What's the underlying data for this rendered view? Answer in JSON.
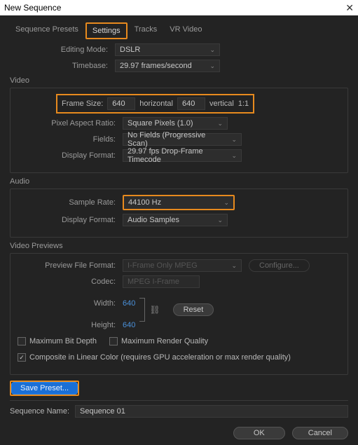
{
  "title": "New Sequence",
  "tabs": {
    "presets": "Sequence Presets",
    "settings": "Settings",
    "tracks": "Tracks",
    "vr": "VR Video"
  },
  "labels": {
    "editingMode": "Editing Mode:",
    "timebase": "Timebase:",
    "video": "Video",
    "frameSize": "Frame Size:",
    "horizontal": "horizontal",
    "vertical": "vertical",
    "par": "Pixel Aspect Ratio:",
    "fields": "Fields:",
    "displayFormat": "Display Format:",
    "audio": "Audio",
    "sampleRate": "Sample Rate:",
    "videoPreviews": "Video Previews",
    "previewFormat": "Preview File Format:",
    "codec": "Codec:",
    "width": "Width:",
    "height": "Height:",
    "maxBitDepth": "Maximum Bit Depth",
    "maxRender": "Maximum Render Quality",
    "linearColor": "Composite in Linear Color (requires GPU acceleration or max render quality)",
    "savePreset": "Save Preset...",
    "seqName": "Sequence Name:",
    "configure": "Configure...",
    "reset": "Reset",
    "ok": "OK",
    "cancel": "Cancel"
  },
  "values": {
    "editingMode": "DSLR",
    "timebase": "29.97 frames/second",
    "frameW": "640",
    "frameH": "640",
    "aspect": "1:1",
    "par": "Square Pixels (1.0)",
    "fields": "No Fields (Progressive Scan)",
    "displayFormatV": "29.97 fps Drop-Frame Timecode",
    "sampleRate": "44100 Hz",
    "displayFormatA": "Audio Samples",
    "previewFormat": "I-Frame Only MPEG",
    "codec": "MPEG I-Frame",
    "previewW": "640",
    "previewH": "640",
    "maxBitDepth": false,
    "maxRender": false,
    "linearColor": true,
    "sequenceName": "Sequence 01"
  }
}
